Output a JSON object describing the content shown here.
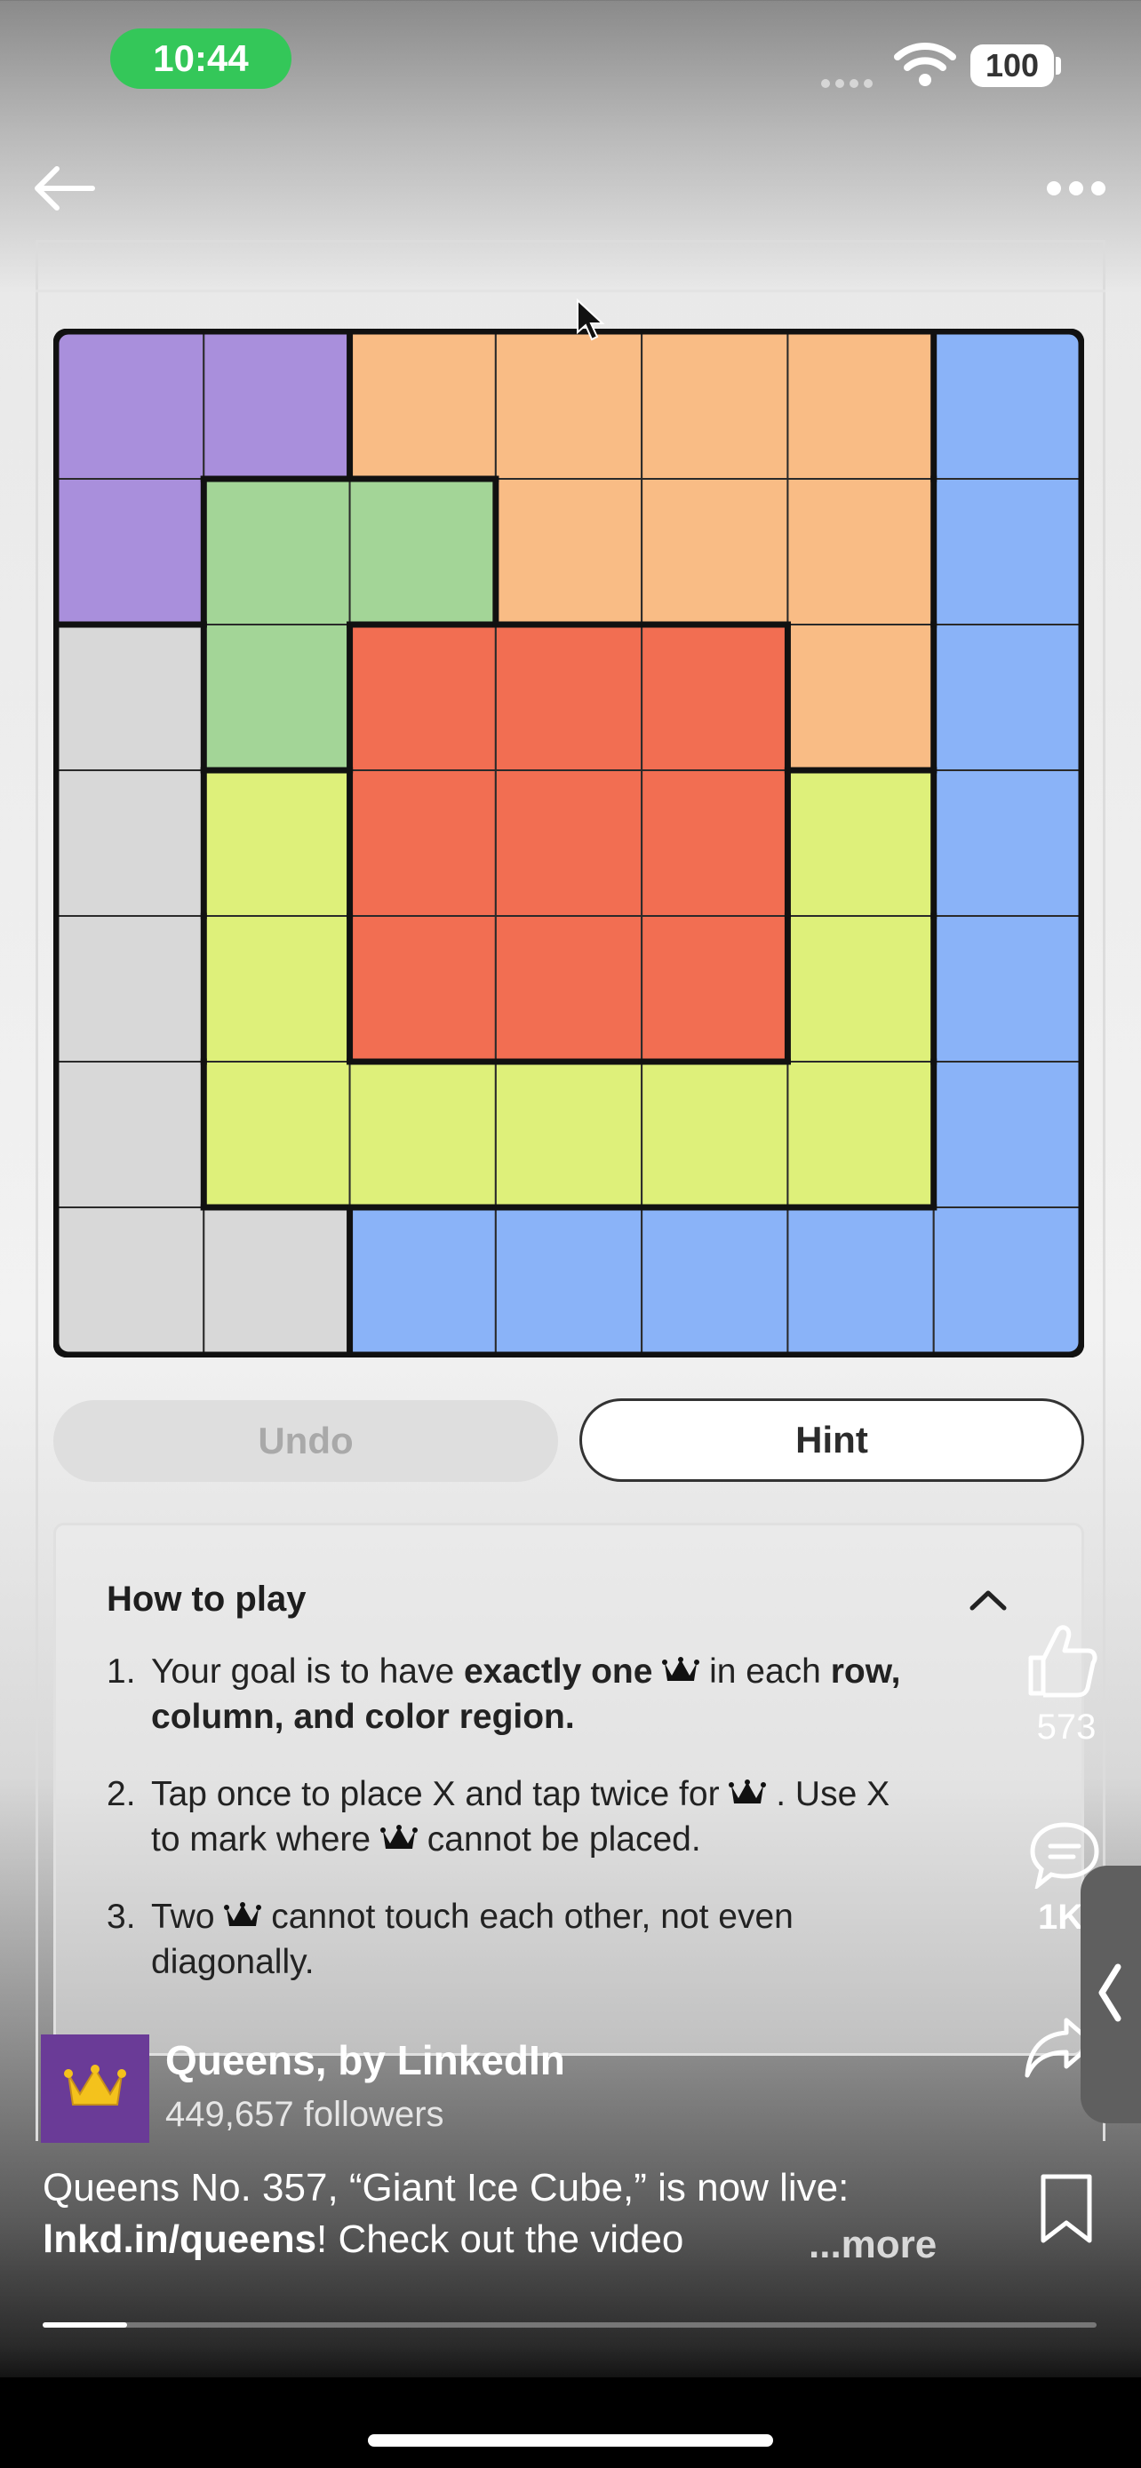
{
  "status_bar": {
    "time": "10:44",
    "battery": "100"
  },
  "board": {
    "size": 7,
    "colors": {
      "P": "#a98fdc",
      "O": "#f9bc85",
      "B": "#8ab3f8",
      "G": "#a3d597",
      "R": "#f26e52",
      "Y": "#def07a",
      "W": "#d8d8d8"
    },
    "rows": [
      [
        "P",
        "P",
        "O",
        "O",
        "O",
        "O",
        "B"
      ],
      [
        "P",
        "G",
        "G",
        "O",
        "O",
        "O",
        "B"
      ],
      [
        "W",
        "G",
        "R",
        "R",
        "R",
        "O",
        "B"
      ],
      [
        "W",
        "Y",
        "R",
        "R",
        "R",
        "Y",
        "B"
      ],
      [
        "W",
        "Y",
        "R",
        "R",
        "R",
        "Y",
        "B"
      ],
      [
        "W",
        "Y",
        "Y",
        "Y",
        "Y",
        "Y",
        "B"
      ],
      [
        "W",
        "W",
        "B",
        "B",
        "B",
        "B",
        "B"
      ]
    ]
  },
  "buttons": {
    "undo": "Undo",
    "hint": "Hint"
  },
  "how_to_play": {
    "title": "How to play",
    "rule1": {
      "num": "1.",
      "a": "Your goal is to have ",
      "b": "exactly one",
      "c": " in each ",
      "d": "row,",
      "e": "column, and color region."
    },
    "rule2": {
      "num": "2.",
      "a": "Tap once to place X and tap twice for",
      "b": ". Use X",
      "c": "to mark where",
      "d": "cannot be placed."
    },
    "rule3": {
      "num": "3.",
      "a": "Two",
      "b": "cannot touch each other, not even",
      "c": "diagonally."
    }
  },
  "actions": {
    "likes": "573",
    "comments": "1K"
  },
  "publisher": {
    "name": "Queens, by LinkedIn",
    "followers": "449,657 followers"
  },
  "caption": {
    "line1": "Queens No. 357, “Giant Ice Cube,” is now live:",
    "link": "lnkd.in/queens",
    "line2_rest": "! Check out the video",
    "more": "...more"
  },
  "video": {
    "progress": 0.08
  }
}
